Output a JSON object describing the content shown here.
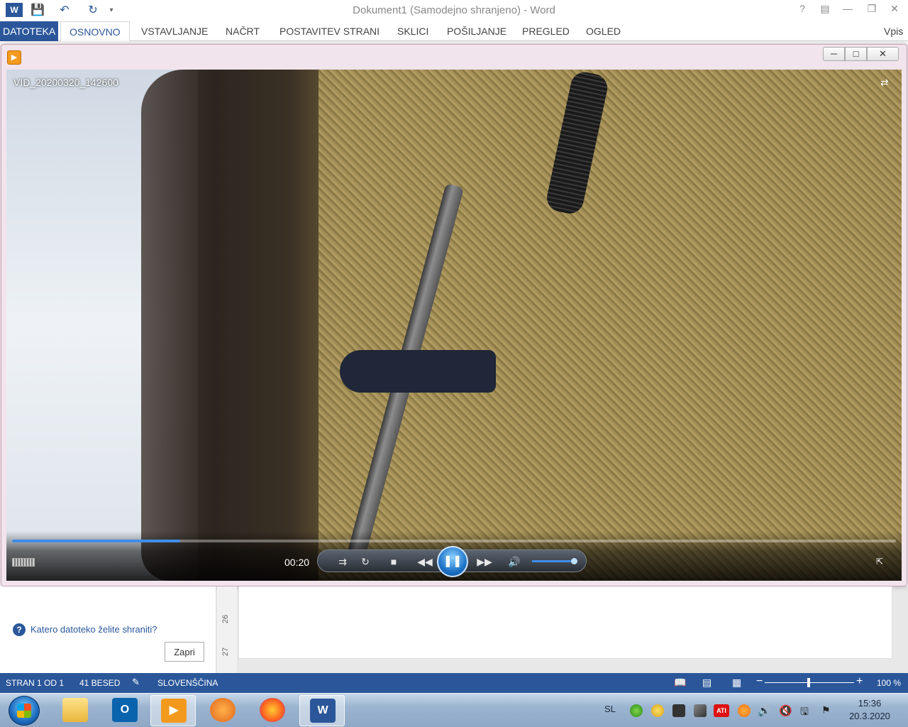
{
  "word": {
    "title": "Dokument1 (Samodejno shranjeno) - Word",
    "help_glyph": "?",
    "tabs": [
      "DATOTEKA",
      "OSNOVNO",
      "VSTAVLJANJE",
      "NAČRT",
      "POSTAVITEV STRANI",
      "SKLICI",
      "POŠILJANJE",
      "PREGLED",
      "OGLED"
    ],
    "signin": "Vpis"
  },
  "player": {
    "video_title": "VID_20200320_142600",
    "time": "00:20",
    "progress": 0.19,
    "volume": 0.8
  },
  "left_pane": {
    "question": "Katero datoteko želite shraniti?",
    "close_label": "Zapri"
  },
  "ruler": {
    "marks": [
      "26",
      "27"
    ]
  },
  "status": {
    "page": "STRAN 1 OD 1",
    "words": "41 BESED",
    "language": "SLOVENŠČINA",
    "zoom": "100 %"
  },
  "taskbar": {
    "language": "SL",
    "time": "15:36",
    "date": "20.3.2020"
  },
  "colors": {
    "word_blue": "#2b579a",
    "seek_blue": "#3f8ee8"
  }
}
